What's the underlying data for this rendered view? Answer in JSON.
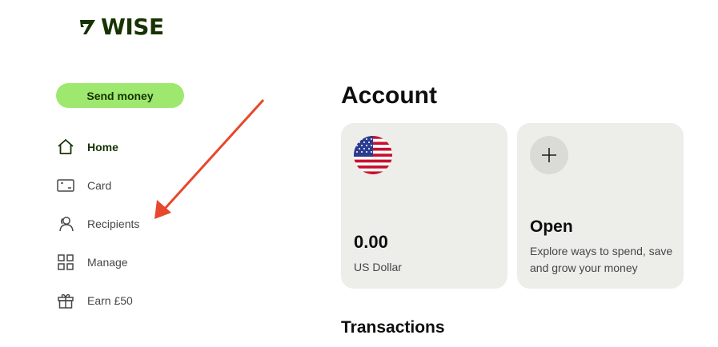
{
  "brand": {
    "name": "WISE",
    "color": "#163300",
    "accent": "#9fe870"
  },
  "sidebar": {
    "send_label": "Send money",
    "items": [
      {
        "label": "Home",
        "icon": "home-icon",
        "active": true
      },
      {
        "label": "Card",
        "icon": "card-icon",
        "active": false
      },
      {
        "label": "Recipients",
        "icon": "recipients-icon",
        "active": false
      },
      {
        "label": "Manage",
        "icon": "manage-grid-icon",
        "active": false
      },
      {
        "label": "Earn £50",
        "icon": "gift-icon",
        "active": false
      }
    ]
  },
  "main": {
    "account_title": "Account",
    "balance_card": {
      "flag": "us-flag-icon",
      "amount": "0.00",
      "currency": "US Dollar"
    },
    "open_card": {
      "icon": "plus-icon",
      "title": "Open",
      "description": "Explore ways to spend, save and grow your money"
    },
    "transactions_title": "Transactions"
  },
  "annotation": {
    "type": "arrow",
    "color": "#e8472b",
    "points_to": "Recipients"
  }
}
